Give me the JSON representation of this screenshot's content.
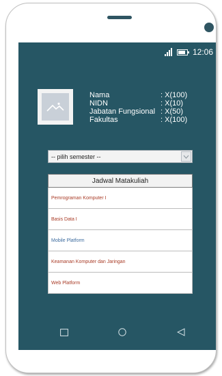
{
  "status_bar": {
    "time": "12:06"
  },
  "profile": {
    "rows": [
      {
        "label": "Nama",
        "value": ": X(100)"
      },
      {
        "label": "NIDN",
        "value": ": X(10)"
      },
      {
        "label": "Jabatan Fungsional",
        "value": ": X(50)"
      },
      {
        "label": "Fakultas",
        "value": ": X(100)"
      }
    ]
  },
  "semester_select": {
    "selected": "-- pilih semester --"
  },
  "schedule": {
    "header": "Jadwal Matakuliah",
    "items": [
      "Pemrograman Komputer I",
      "Basis Data I",
      "Mobile Platform",
      "Keamanan Komputer dan Jaringan",
      "Web Platform"
    ]
  },
  "colors": {
    "screen_bg": "#265664",
    "link_red": "#a83a25",
    "link_blue": "#3c6b9e"
  },
  "icons": {
    "avatar": "image-placeholder-icon",
    "nav": [
      "square-recents-icon",
      "circle-home-icon",
      "triangle-back-icon"
    ]
  }
}
